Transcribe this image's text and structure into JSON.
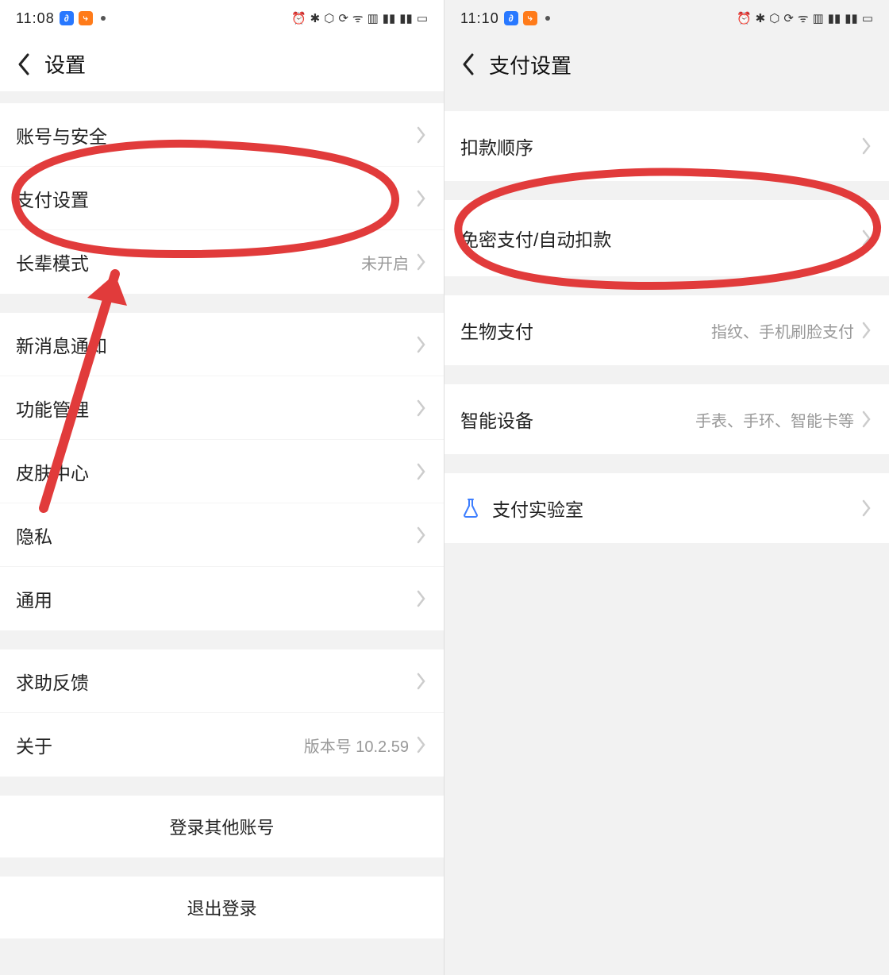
{
  "left": {
    "status": {
      "time": "11:08",
      "icons": "⏰ ✱ ⬡ ⟳ ᯤ ▥ ▮▮ ▮▮ ▭"
    },
    "title": "设置",
    "rows": [
      {
        "label": "账号与安全",
        "value": ""
      },
      {
        "label": "支付设置",
        "value": ""
      },
      {
        "label": "长辈模式",
        "value": "未开启"
      },
      {
        "label": "新消息通知",
        "value": ""
      },
      {
        "label": "功能管理",
        "value": ""
      },
      {
        "label": "皮肤中心",
        "value": ""
      },
      {
        "label": "隐私",
        "value": ""
      },
      {
        "label": "通用",
        "value": ""
      },
      {
        "label": "求助反馈",
        "value": ""
      },
      {
        "label": "关于",
        "value": "版本号 10.2.59"
      }
    ],
    "login_other": "登录其他账号",
    "logout": "退出登录"
  },
  "right": {
    "status": {
      "time": "11:10",
      "icons": "⏰ ✱ ⬡ ⟳ ᯤ ▥ ▮▮ ▮▮ ▭"
    },
    "title": "支付设置",
    "rows": [
      {
        "label": "扣款顺序",
        "value": ""
      },
      {
        "label": "免密支付/自动扣款",
        "value": ""
      },
      {
        "label": "生物支付",
        "value": "指纹、手机刷脸支付"
      },
      {
        "label": "智能设备",
        "value": "手表、手环、智能卡等"
      },
      {
        "label": "支付实验室",
        "value": "",
        "icon": "flask"
      }
    ]
  }
}
